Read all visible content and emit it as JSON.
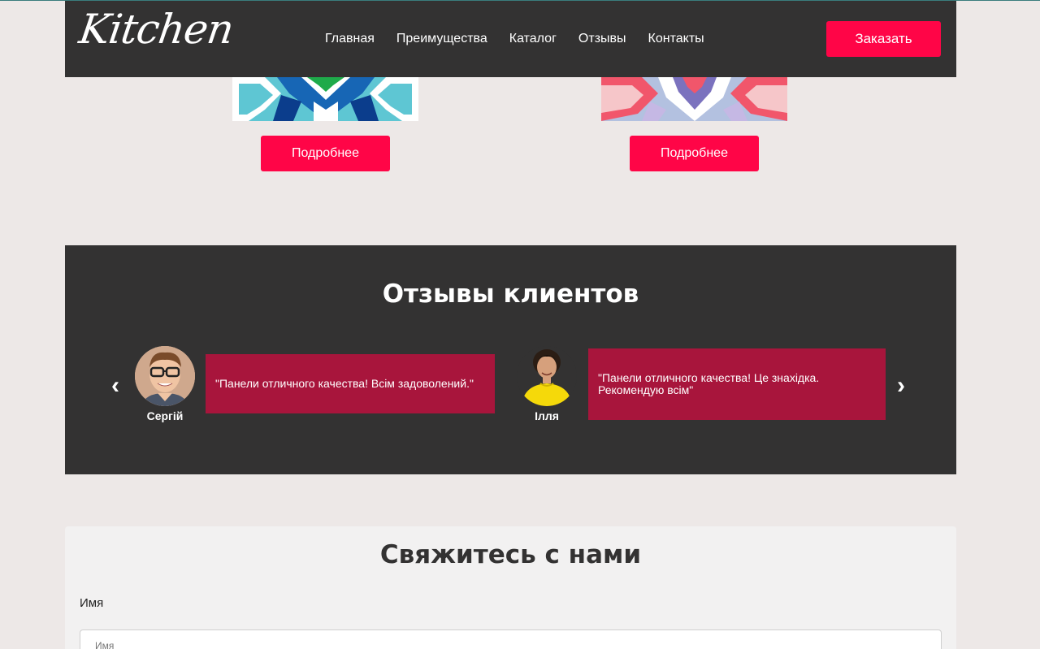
{
  "header": {
    "logo": "Kitchen",
    "nav": [
      "Главная",
      "Преимущества",
      "Каталог",
      "Отзывы",
      "Контакты"
    ],
    "order_button": "Заказать"
  },
  "catalog": {
    "more_button_1": "Подробнее",
    "more_button_2": "Подробнее"
  },
  "reviews": {
    "title": "Отзывы клиентов",
    "prev_arrow": "‹",
    "next_arrow": "›",
    "items": [
      {
        "name": "Сергій",
        "text": "\"Панели отличного качества! Всім задоволений.\""
      },
      {
        "name": "Ілля",
        "text": "\"Панели отличного качества! Це знахідка. Рекомендую всім\""
      }
    ]
  },
  "contact": {
    "title": "Свяжитесь с нами",
    "name_label": "Имя",
    "name_placeholder": "Имя"
  },
  "colors": {
    "accent": "#ff0547",
    "dark": "#333232",
    "quote_bg": "#a8153c",
    "page_bg": "#ede8e7"
  }
}
